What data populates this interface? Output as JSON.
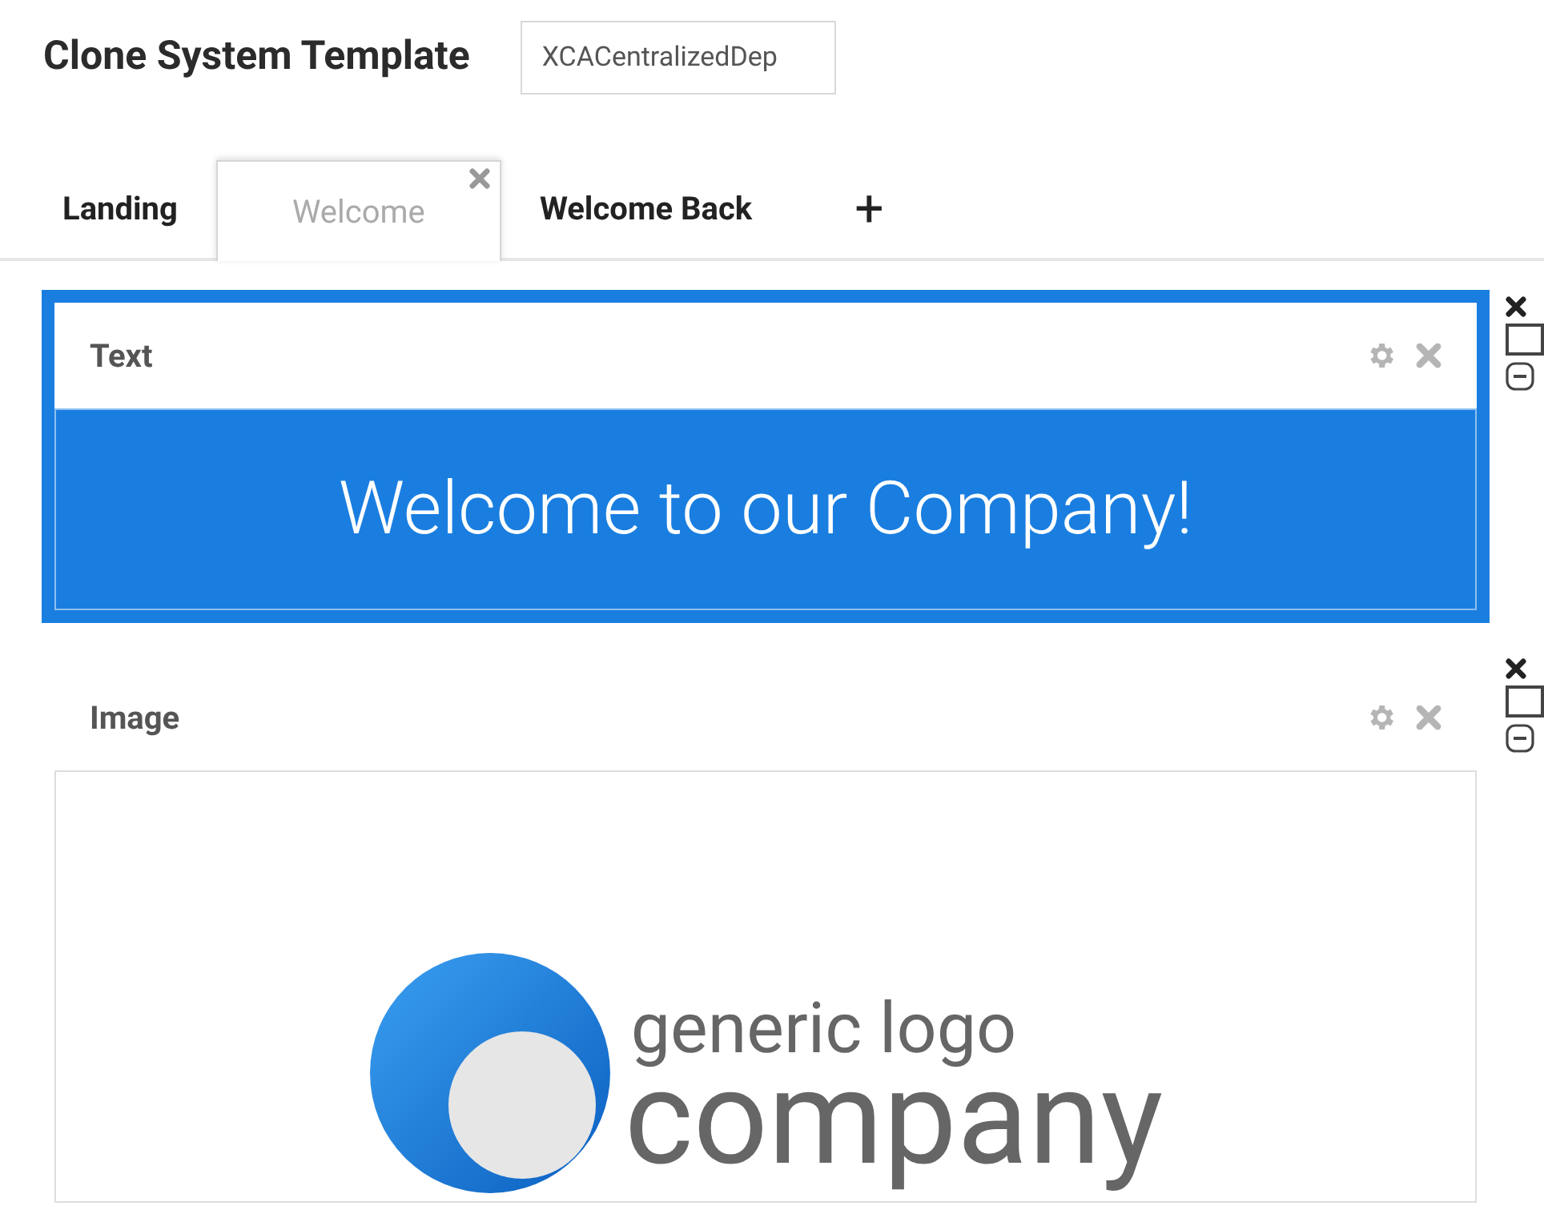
{
  "header": {
    "title": "Clone System Template",
    "name_field": {
      "value": "XCACentralizedDep"
    }
  },
  "tabs": [
    {
      "label": "Landing",
      "selected": false,
      "closable": false
    },
    {
      "label": "Welcome",
      "selected": true,
      "closable": true
    },
    {
      "label": "Welcome Back",
      "selected": false,
      "closable": false
    }
  ],
  "add_tab": {
    "label": "+"
  },
  "widgets": [
    {
      "kind": "text",
      "title": "Text",
      "selected": true,
      "checked": false,
      "content": "Welcome to our Company!"
    },
    {
      "kind": "image",
      "title": "Image",
      "selected": false,
      "checked": false,
      "logo": {
        "tagline": "generic logo",
        "name": "company"
      }
    }
  ]
}
